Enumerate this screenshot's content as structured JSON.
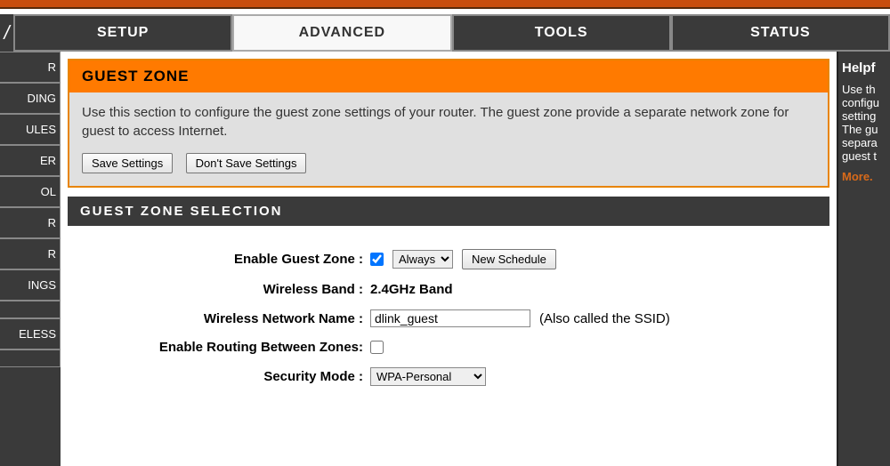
{
  "nav": {
    "tabs": [
      "SETUP",
      "ADVANCED",
      "TOOLS",
      "STATUS"
    ]
  },
  "sidebar": {
    "items": [
      "R",
      "DING",
      "ULES",
      "ER",
      "OL",
      "R",
      "R",
      "INGS",
      "",
      "ELESS",
      ""
    ]
  },
  "guest_zone": {
    "title": "GUEST ZONE",
    "description": "Use this section to configure the guest zone settings of your router. The guest zone provide a separate network zone for guest to access Internet.",
    "save_btn": "Save Settings",
    "dont_save_btn": "Don't Save Settings"
  },
  "selection": {
    "title": "GUEST ZONE SELECTION",
    "enable_label": "Enable Guest Zone :",
    "enable_checked": true,
    "schedule_value": "Always",
    "new_schedule_btn": "New Schedule",
    "band_label": "Wireless Band :",
    "band_value": "2.4GHz Band",
    "ssid_label": "Wireless Network Name :",
    "ssid_value": "dlink_guest",
    "ssid_hint": "(Also called the SSID)",
    "routing_label": "Enable Routing Between Zones:",
    "routing_checked": false,
    "security_label": "Security Mode :",
    "security_value": "WPA-Personal"
  },
  "help": {
    "title": "Helpf",
    "lines": [
      "Use th",
      "configu",
      "setting",
      "The gu",
      "separa",
      "guest t"
    ],
    "more": "More."
  }
}
